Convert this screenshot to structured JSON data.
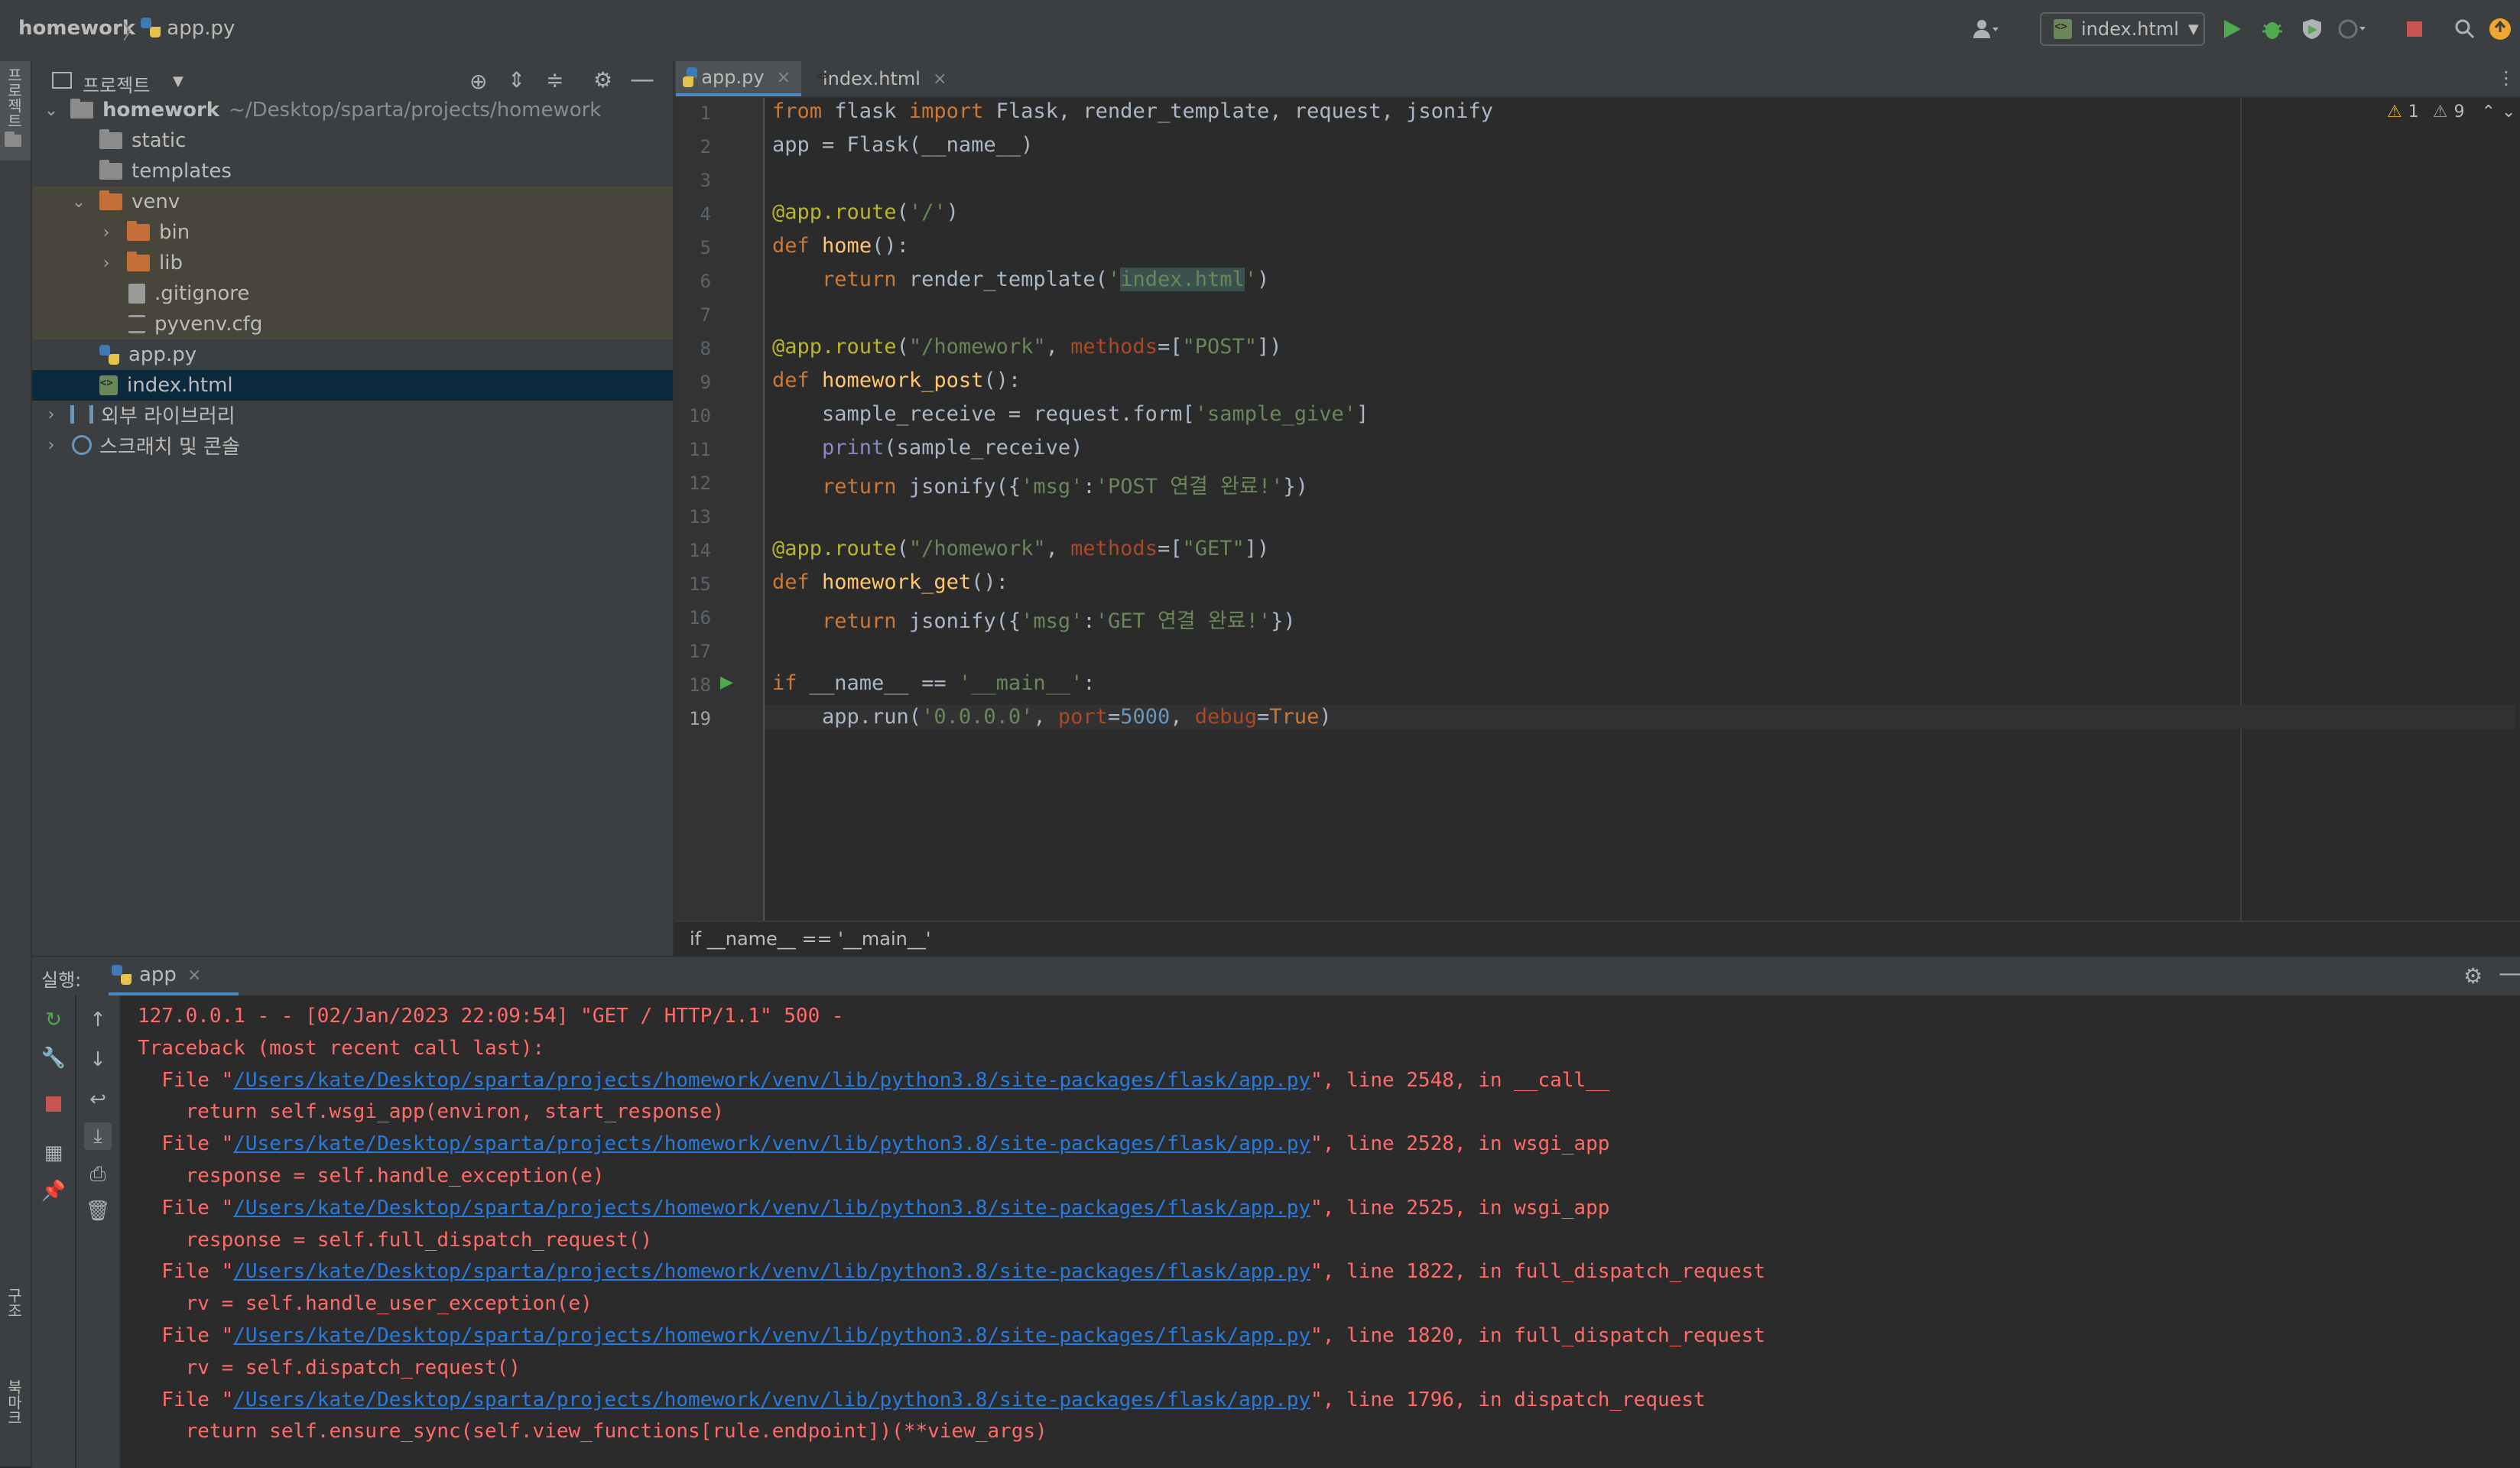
{
  "toolbar": {
    "breadcrumb_project": "homework",
    "breadcrumb_sep": "〉",
    "breadcrumb_file": "app.py",
    "run_config": "index.html",
    "user_icon": "user-icon"
  },
  "left_strip": {
    "project_label": "프로젝트",
    "structure_label": "구조",
    "bookmarks_label": "북마크"
  },
  "project_panel": {
    "title": "프로젝트",
    "tree": {
      "root_name": "homework",
      "root_path": "~/Desktop/sparta/projects/homework",
      "static": "static",
      "templates": "templates",
      "venv": "venv",
      "bin": "bin",
      "lib": "lib",
      "gitignore": ".gitignore",
      "pyvenv": "pyvenv.cfg",
      "app_py": "app.py",
      "index_html": "index.html",
      "external_libs": "외부 라이브러리",
      "scratches": "스크래치 및 콘솔"
    }
  },
  "editor": {
    "tabs": [
      {
        "label": "app.py",
        "active": true
      },
      {
        "label": "index.html",
        "active": false
      }
    ],
    "inspections": {
      "warnings_a": "1",
      "warnings_b": "9"
    },
    "line_numbers": [
      "1",
      "2",
      "3",
      "4",
      "5",
      "6",
      "7",
      "8",
      "9",
      "10",
      "11",
      "12",
      "13",
      "14",
      "15",
      "16",
      "17",
      "18",
      "19"
    ],
    "code_lines": [
      "from flask import Flask, render_template, request, jsonify",
      "app = Flask(__name__)",
      "",
      "@app.route('/')",
      "def home():",
      "    return render_template('index.html')",
      "",
      "@app.route(\"/homework\", methods=[\"POST\"])",
      "def homework_post():",
      "    sample_receive = request.form['sample_give']",
      "    print(sample_receive)",
      "    return jsonify({'msg':'POST 연결 완료!'})",
      "",
      "@app.route(\"/homework\", methods=[\"GET\"])",
      "def homework_get():",
      "    return jsonify({'msg':'GET 연결 완료!'})",
      "",
      "if __name__ == '__main__':",
      "    app.run('0.0.0.0', port=5000, debug=True)"
    ],
    "breadcrumb": "if __name__ == '__main__'"
  },
  "run_panel": {
    "label": "실행:",
    "tab": "app",
    "lines": [
      {
        "pre": "127.0.0.1 - - [02/Jan/2023 22:09:54] \"GET / HTTP/1.1\" 500 -",
        "link": "",
        "post": ""
      },
      {
        "pre": "Traceback (most recent call last):",
        "link": "",
        "post": ""
      },
      {
        "pre": "  File \"",
        "link": "/Users/kate/Desktop/sparta/projects/homework/venv/lib/python3.8/site-packages/flask/app.py",
        "post": "\", line 2548, in __call__"
      },
      {
        "pre": "    return self.wsgi_app(environ, start_response)",
        "link": "",
        "post": ""
      },
      {
        "pre": "  File \"",
        "link": "/Users/kate/Desktop/sparta/projects/homework/venv/lib/python3.8/site-packages/flask/app.py",
        "post": "\", line 2528, in wsgi_app"
      },
      {
        "pre": "    response = self.handle_exception(e)",
        "link": "",
        "post": ""
      },
      {
        "pre": "  File \"",
        "link": "/Users/kate/Desktop/sparta/projects/homework/venv/lib/python3.8/site-packages/flask/app.py",
        "post": "\", line 2525, in wsgi_app"
      },
      {
        "pre": "    response = self.full_dispatch_request()",
        "link": "",
        "post": ""
      },
      {
        "pre": "  File \"",
        "link": "/Users/kate/Desktop/sparta/projects/homework/venv/lib/python3.8/site-packages/flask/app.py",
        "post": "\", line 1822, in full_dispatch_request"
      },
      {
        "pre": "    rv = self.handle_user_exception(e)",
        "link": "",
        "post": ""
      },
      {
        "pre": "  File \"",
        "link": "/Users/kate/Desktop/sparta/projects/homework/venv/lib/python3.8/site-packages/flask/app.py",
        "post": "\", line 1820, in full_dispatch_request"
      },
      {
        "pre": "    rv = self.dispatch_request()",
        "link": "",
        "post": ""
      },
      {
        "pre": "  File \"",
        "link": "/Users/kate/Desktop/sparta/projects/homework/venv/lib/python3.8/site-packages/flask/app.py",
        "post": "\", line 1796, in dispatch_request"
      },
      {
        "pre": "    return self.ensure_sync(self.view_functions[rule.endpoint])(**view_args)",
        "link": "",
        "post": ""
      }
    ]
  },
  "colors": {
    "background": "#2b2b2b",
    "panel": "#3c3f41",
    "keyword": "#cc7832",
    "string": "#6a8759",
    "decorator": "#bbb529",
    "error_text": "#ff6b68",
    "link": "#287bde",
    "run_green": "#4fa94d",
    "stop_red": "#c75450"
  }
}
